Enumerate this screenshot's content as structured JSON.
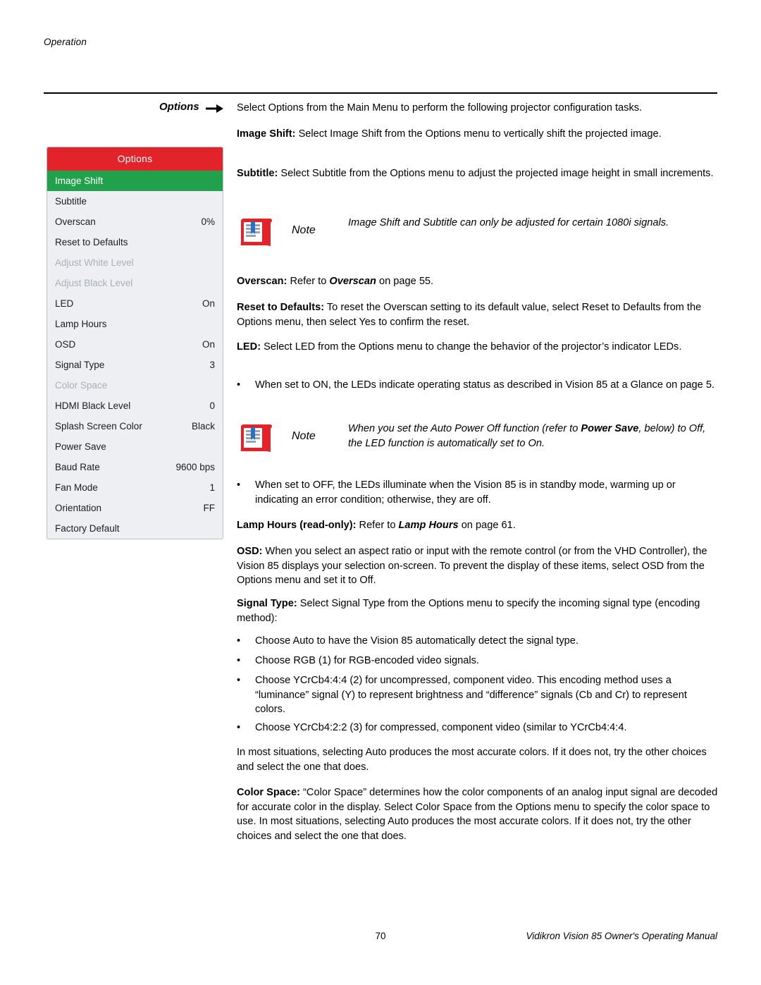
{
  "page": {
    "running_head": "Operation",
    "section_title": "Options",
    "footer_page_number": "70",
    "footer_manual": "Vidikron Vision 85 Owner's Operating Manual"
  },
  "osd": {
    "title": "Options",
    "rows": [
      {
        "label": "Image Shift",
        "value": "",
        "state": "selected"
      },
      {
        "label": "Subtitle",
        "value": "",
        "state": "normal"
      },
      {
        "label": "Overscan",
        "value": "0%",
        "state": "normal"
      },
      {
        "label": "Reset to Defaults",
        "value": "",
        "state": "normal"
      },
      {
        "label": "Adjust White Level",
        "value": "",
        "state": "dimmed"
      },
      {
        "label": "Adjust Black Level",
        "value": "",
        "state": "dimmed"
      },
      {
        "label": "LED",
        "value": "On",
        "state": "normal"
      },
      {
        "label": "Lamp Hours",
        "value": "",
        "state": "normal"
      },
      {
        "label": "OSD",
        "value": "On",
        "state": "normal"
      },
      {
        "label": "Signal Type",
        "value": "3",
        "state": "normal"
      },
      {
        "label": "Color Space",
        "value": "",
        "state": "dimmed"
      },
      {
        "label": "HDMI Black Level",
        "value": "0",
        "state": "normal"
      },
      {
        "label": "Splash Screen Color",
        "value": "Black",
        "state": "normal"
      },
      {
        "label": "Power Save",
        "value": "",
        "state": "normal"
      },
      {
        "label": "Baud Rate",
        "value": "9600 bps",
        "state": "normal"
      },
      {
        "label": "Fan Mode",
        "value": "1",
        "state": "normal"
      },
      {
        "label": "Orientation",
        "value": "FF",
        "state": "normal"
      },
      {
        "label": "Factory Default",
        "value": "",
        "state": "normal"
      }
    ],
    "colors": {
      "title_bar": "#e2232a",
      "selected_row": "#21a14b",
      "background": "#edeff2",
      "dimmed_text": "#a8b0b8"
    }
  },
  "content": {
    "intro": "Select Options from the Main Menu to perform the following projector configuration tasks.",
    "image_shift_term": "Image Shift:",
    "image_shift_body": " Select Image Shift from the Options menu to vertically shift the projected image.",
    "subtitle_term": "Subtitle:",
    "subtitle_body": " Select Subtitle from the Options menu to adjust the projected image height in small increments.",
    "note1_label": "Note",
    "note1_text": "Image Shift and Subtitle can only be adjusted for certain 1080i signals.",
    "overscan_term": "Overscan:",
    "overscan_body_a": " Refer to ",
    "overscan_body_em": "Overscan",
    "overscan_body_b": " on page 55.",
    "reset_term": "Reset to Defaults:",
    "reset_body": " To reset the Overscan setting to its default value, select Reset to Defaults from the Options menu, then select Yes to confirm the reset.",
    "led_term": "LED:",
    "led_body": " Select LED from the Options menu to change the behavior of the projector’s indicator LEDs.",
    "led_bullet1_a": "When set to ON, the LEDs indicate operating status as described in ",
    "led_bullet1_em": "Vision 85 at a Glance",
    "led_bullet1_b": " on page 5.",
    "note2_label": "Note",
    "note2_text_a": "When you set the Auto Power Off function (refer to ",
    "note2_text_em": "Power Save",
    "note2_text_b": ", below) to Off, the LED function is automatically set to On.",
    "led_bullet2": "When set to OFF, the LEDs illuminate when the Vision 85 is in standby mode, warming up or indicating an error condition; otherwise, they are off.",
    "lamp_hours_term": "Lamp Hours (read-only):",
    "lamp_hours_body_a": " Refer to ",
    "lamp_hours_body_em": "Lamp Hours",
    "lamp_hours_body_b": " on page 61.",
    "osd_term": "OSD:",
    "osd_body": " When you select an aspect ratio or input with the remote control (or from the VHD Controller), the Vision 85 displays your selection on-screen. To prevent the display of these items, select OSD from the Options menu and set it to Off.",
    "signal_type_term": "Signal Type:",
    "signal_type_body": " Select Signal Type from the Options menu to specify the incoming signal type (encoding method):",
    "signal_bullet1": "Choose Auto to have the Vision 85 automatically detect the signal type.",
    "signal_bullet2": "Choose RGB (1) for RGB-encoded video signals.",
    "signal_bullet3": "Choose YCrCb4:4:4 (2) for uncompressed, component video. This encoding method uses a “luminance” signal (Y) to represent brightness and “difference” signals (Cb and Cr) to represent colors.",
    "signal_bullet4": "Choose YCrCb4:2:2 (3) for compressed, component video (similar to YCrCb4:4:4.",
    "signal_closing": "In most situations, selecting Auto produces the most accurate colors. If it does not, try the other choices and select the one that does.",
    "color_space_term": "Color Space:",
    "color_space_body": " “Color Space” determines how the color components of an analog input signal are decoded for accurate color in the display. Select Color Space from the Options menu to specify the color space to use. In most situations, selecting Auto produces the most accurate colors. If it does not, try the other choices and select the one that does."
  }
}
